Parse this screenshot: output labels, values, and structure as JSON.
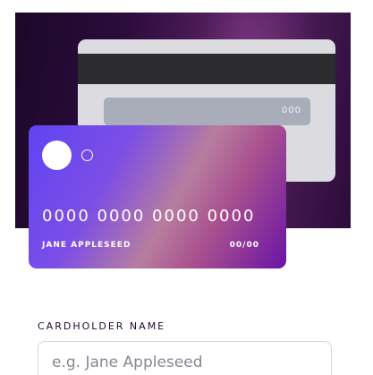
{
  "card": {
    "cvc": "000",
    "number": "0000 0000 0000 0000",
    "holder_name": "JANE APPLESEED",
    "expiry": "00/00"
  },
  "form": {
    "cardholder_name_label": "CARDHOLDER NAME",
    "cardholder_name_placeholder": "e.g. Jane Appleseed",
    "cardholder_name_value": ""
  },
  "colors": {
    "hero_dark": "#2b0c3c",
    "card_front_start": "#5f44f2",
    "card_front_end": "#6a14a6",
    "label_text": "#21092f"
  }
}
